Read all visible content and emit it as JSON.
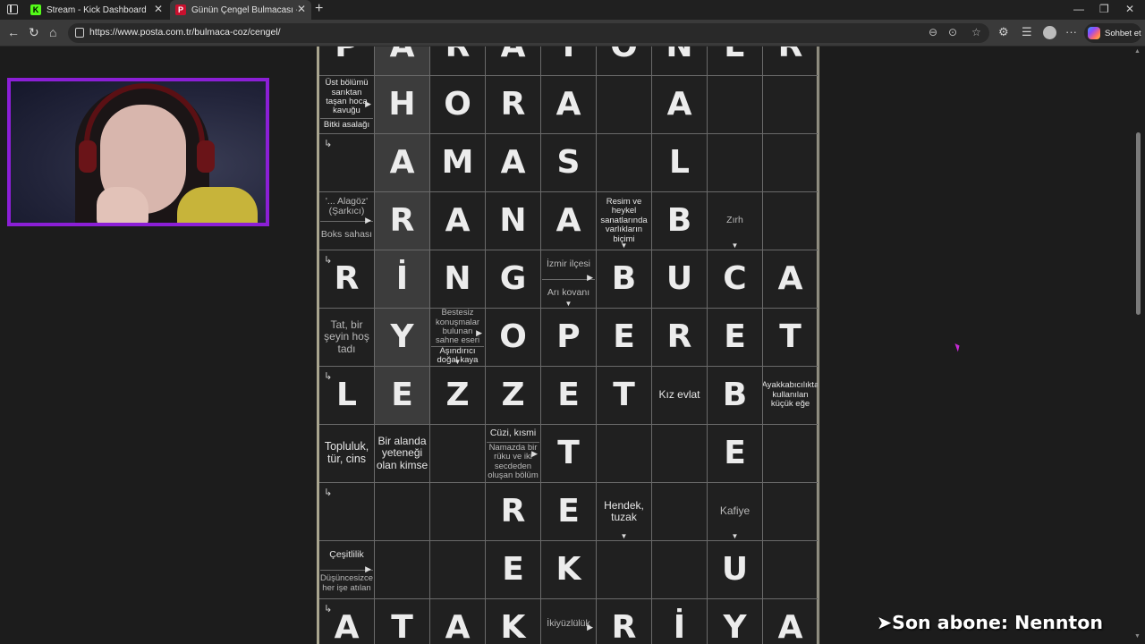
{
  "browser": {
    "tabs": [
      {
        "title": "Stream - Kick Dashboard",
        "favicon": "K"
      },
      {
        "title": "Günün Çengel Bulmacası - Bugün",
        "favicon": "P"
      }
    ],
    "url": "https://www.posta.com.tr/bulmaca-coz/cengel/",
    "chat_label": "Sohbet et"
  },
  "overlay": {
    "sub_alert": "➤Son abone: Nennton"
  },
  "crossword": {
    "r0": [
      "P",
      "A",
      "R",
      "A",
      "T",
      "O",
      "N",
      "E",
      "R"
    ],
    "r1": {
      "c0": "Üst bölümü sarıktan taşan hoca kavuğu",
      "c0b": "Bitki asalağı",
      "c1": "H",
      "c2": "O",
      "c3": "R",
      "c4": "A",
      "c6": "A"
    },
    "r2": {
      "c1": "A",
      "c2": "M",
      "c3": "A",
      "c4": "S",
      "c6": "L"
    },
    "r3": {
      "c0": "'... Alagöz' (Şarkıcı)",
      "c0b": "Boks sahası",
      "c1": "R",
      "c2": "A",
      "c3": "N",
      "c4": "A",
      "c5": "Resim ve heykel sanatlarında varlıkların biçimi",
      "c6": "B",
      "c7": "Zırh"
    },
    "r4": {
      "c0": "R",
      "c1": "İ",
      "c2": "N",
      "c3": "G",
      "c4": "İzmir ilçesi",
      "c4b": "Arı kovanı",
      "c5": "B",
      "c6": "U",
      "c7": "C",
      "c8": "A"
    },
    "r5": {
      "c0": "Tat, bir şeyin hoş tadı",
      "c1": "Y",
      "c2": "Bestesiz konuşmalar bulunan sahne eseri",
      "c2b": "Aşındırıcı doğal kaya",
      "c3": "O",
      "c4": "P",
      "c5": "E",
      "c6": "R",
      "c7": "E",
      "c8": "T"
    },
    "r6": {
      "c0": "L",
      "c1": "E",
      "c2": "Z",
      "c3": "Z",
      "c4": "E",
      "c5": "T",
      "c6": "Kız evlat",
      "c7": "B",
      "c8": "Ayakkabıcılıkta kullanılan küçük eğe"
    },
    "r7": {
      "c0": "Topluluk, tür, cins",
      "c1": "Bir alanda yeteneği olan kimse",
      "c3": "Cüzi, kısmi",
      "c3b": "Namazda bir rüku ve iki secdeden oluşan bölüm",
      "c4": "T",
      "c7": "E"
    },
    "r8": {
      "c3": "R",
      "c4": "E",
      "c5": "Hendek, tuzak",
      "c7": "Kafiye"
    },
    "r9": {
      "c0": "Çeşitlilik",
      "c0b": "Düşüncesizce her işe atılan",
      "c3": "E",
      "c4": "K",
      "c7": "U"
    },
    "r10": {
      "c0": "A",
      "c1": "T",
      "c2": "A",
      "c3": "K",
      "c4": "İkiyüzlülük",
      "c5": "R",
      "c6": "İ",
      "c7": "Y",
      "c8": "A"
    }
  }
}
